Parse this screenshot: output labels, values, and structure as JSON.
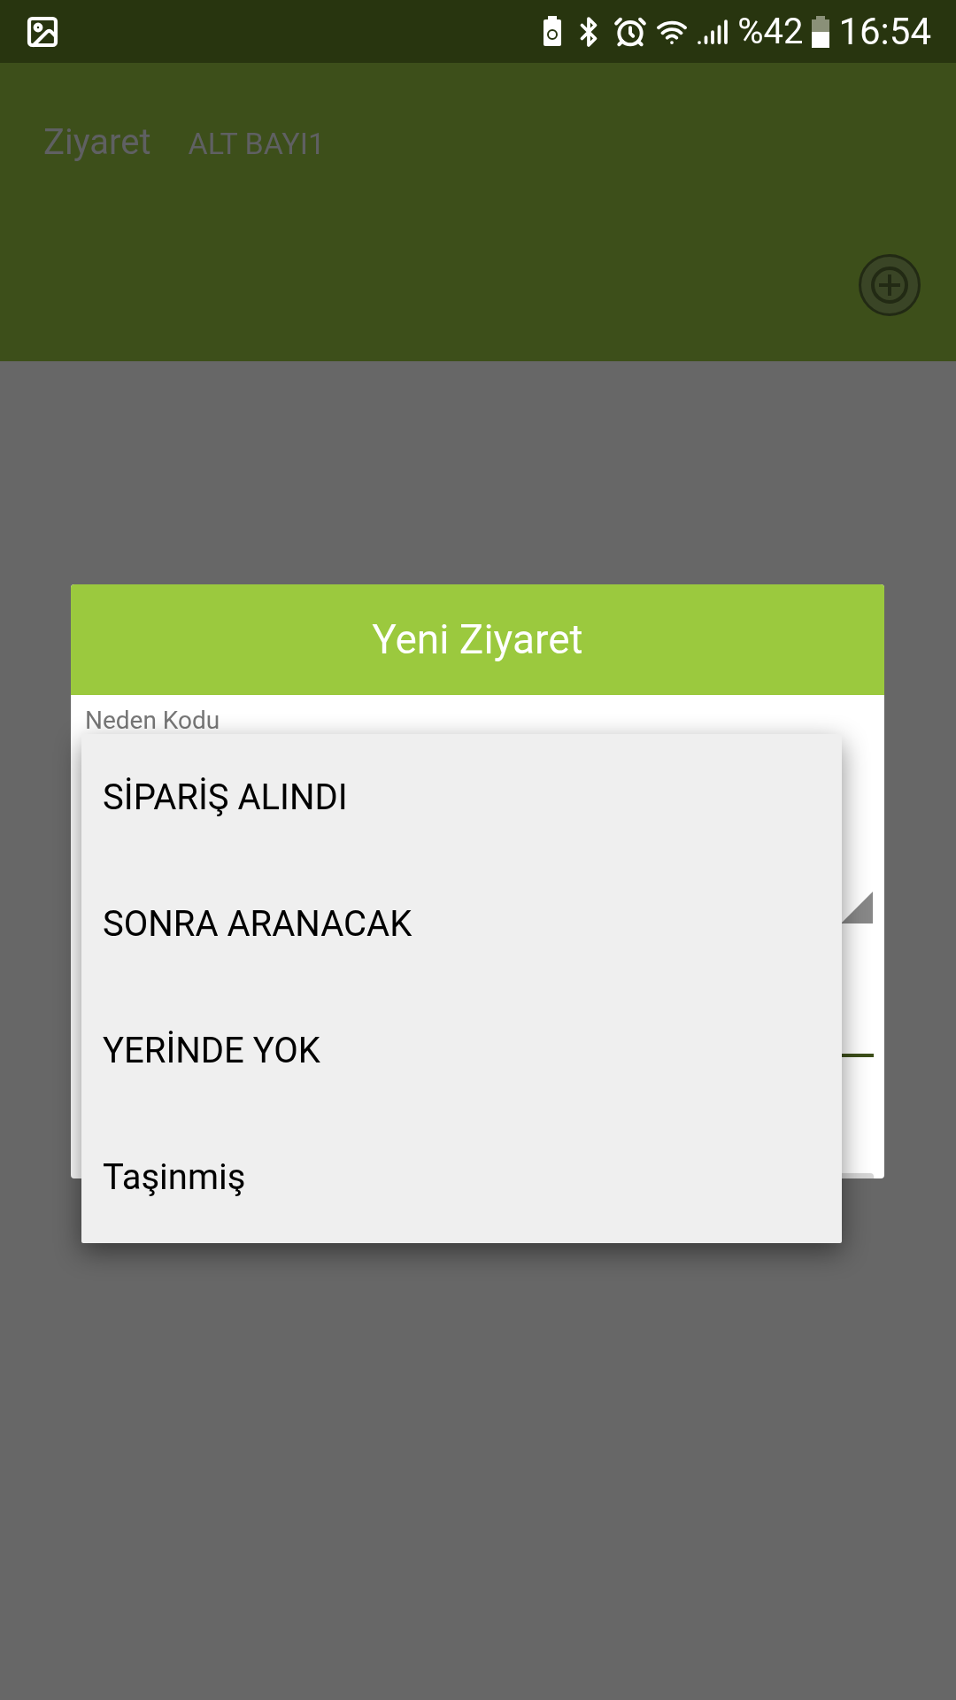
{
  "status_bar": {
    "battery": "%42",
    "time": "16:54"
  },
  "app_bar": {
    "title": "Ziyaret",
    "subtitle": "ALT BAYI1"
  },
  "dialog": {
    "title": "Yeni Ziyaret",
    "field_label": "Neden Kodu"
  },
  "dropdown": {
    "options": [
      {
        "label": "SİPARİŞ ALINDI"
      },
      {
        "label": "SONRA ARANACAK"
      },
      {
        "label": "YERİNDE YOK"
      },
      {
        "label": "Taşinmiş"
      }
    ]
  }
}
